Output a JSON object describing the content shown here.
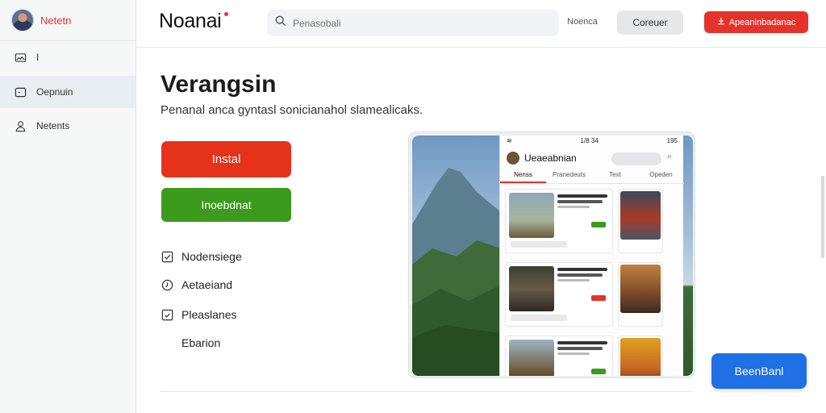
{
  "user": {
    "name": "Netetn"
  },
  "sidebar": {
    "items": [
      {
        "label": "I",
        "icon": "image-icon"
      },
      {
        "label": "Oepnuin",
        "icon": "window-icon",
        "active": true
      },
      {
        "label": "Netents",
        "icon": "user-icon"
      }
    ]
  },
  "header": {
    "brand": "Noanai",
    "search_placeholder": "Penasobali",
    "link": "Noenca",
    "grey_button": "Coreuer",
    "red_button": "Apeaninbadanac"
  },
  "main": {
    "title": "Verangsin",
    "subtitle": "Penanal anca gyntasl sonicianahol slamealicaks.",
    "install_button": "Instal",
    "secondary_button": "Inoebdnat",
    "options": [
      {
        "label": "Nodensiege",
        "icon": "checkbox-icon"
      },
      {
        "label": "Aetaeiand",
        "icon": "clock-icon"
      },
      {
        "label": "Pleaslanes",
        "icon": "checkbox-icon"
      },
      {
        "label": "Ebarion",
        "icon": ""
      }
    ]
  },
  "preview": {
    "status_time": "1/8 34",
    "status_right": "195",
    "app_title": "Ueaeabnian",
    "tabs": [
      "Nenss",
      "Pranedeuts",
      "Text",
      "Opeden"
    ]
  },
  "floating_button": "BeenBanl",
  "colors": {
    "accent_red": "#e5322b",
    "green": "#3c9a1c",
    "blue": "#1f6fe5"
  }
}
